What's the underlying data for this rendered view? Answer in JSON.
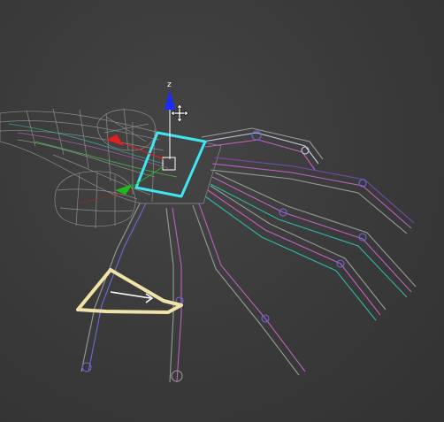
{
  "viewport": {
    "gizmo_axis_label": "z",
    "colors": {
      "background": "#3a3a3a",
      "mesh_grey": "#9a9a9a",
      "bone_pink": "#c060c0",
      "bone_blue": "#6a6ad8",
      "bone_cyan": "#2fb7a8",
      "selection_box": "#3fe6f0",
      "gizmo_z": "#1a2cff",
      "gizmo_x": "#e02020",
      "gizmo_y": "#1fb81f",
      "ik_handle": "#f1e3a8"
    },
    "icons": [
      "move-cursor-icon",
      "z-axis-arrow-icon",
      "x-axis-arrow-icon",
      "y-axis-arrow-icon",
      "ik-handle-icon"
    ]
  }
}
